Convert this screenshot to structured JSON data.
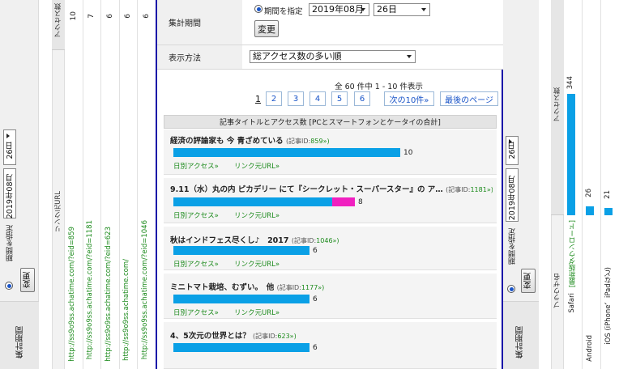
{
  "form": {
    "period_label": "集計期間",
    "radio_label": "期間を指定",
    "month_value": "2019年08月",
    "day_value": "26日",
    "change_button": "変更",
    "display_label": "表示方法",
    "sort_value": "総アクセス数の多い順"
  },
  "pagination": {
    "summary": "全 60 件中 1 - 10 件表示",
    "current": "1",
    "pages": [
      "2",
      "3",
      "4",
      "5",
      "6"
    ],
    "next": "次の10件»",
    "last": "最後のページ"
  },
  "section_header": "記事タイトルとアクセス数 [PCとスマートフォンとケータイの合計]",
  "articles": [
    {
      "title": "経済の評論家も 今 青ざめている",
      "id_prefix": "(記事ID:",
      "id": "859",
      "id_suffix": "»)",
      "blue": 10,
      "pink": 0,
      "count": "10",
      "daily": "日別アクセス»",
      "ref": "リンク元URL»"
    },
    {
      "title": "9.11（水）丸の内 ピカデリー にて『シークレット・スーパースター』の ア…",
      "id_prefix": "(記事ID:",
      "id": "1181",
      "id_suffix": "»)",
      "blue": 7,
      "pink": 1,
      "count": "8",
      "daily": "日別アクセス»",
      "ref": "リンク元URL»"
    },
    {
      "title": "秋はインドフェス尽くし♪　2017",
      "id_prefix": "(記事ID:",
      "id": "1046",
      "id_suffix": "»)",
      "blue": 6,
      "pink": 0,
      "count": "6",
      "daily": "日別アクセス»",
      "ref": "リンク元URL»"
    },
    {
      "title": "ミニトマト栽培、むずい。　他",
      "id_prefix": "(記事ID:",
      "id": "1177",
      "id_suffix": "»)",
      "blue": 6,
      "pink": 0,
      "count": "6",
      "daily": "日別アクセス»",
      "ref": "リンク元URL»"
    },
    {
      "title": "4、5次元の世界とは？",
      "id_prefix": "(記事ID:",
      "id": "623",
      "id_suffix": "»)",
      "blue": 6,
      "pink": 0,
      "count": "6",
      "daily": "",
      "ref": ""
    }
  ],
  "left_panel": {
    "period_label": "集計期間",
    "radio_label": "期間を指定",
    "month_value": "2019年08月",
    "day_value": "26日",
    "change_button": "変更",
    "col_header_access": "アクセス数",
    "col_header_url": "リンク元URL",
    "rows": [
      {
        "url": "http://ss9o9ss.achatime.com/?eid=859",
        "count": "10"
      },
      {
        "url": "http://ss9o9ss.achatime.com/?eid=1181",
        "count": "7"
      },
      {
        "url": "http://ss9o9ss.achatime.com/?eid=623",
        "count": "6"
      },
      {
        "url": "http://ss9o9ss.achatime.com/",
        "count": "6"
      },
      {
        "url": "http://ss9o9ss.achatime.com/?eid=1046",
        "count": "6"
      }
    ]
  },
  "right_panel": {
    "period_label": "集計期間",
    "radio_label": "期間を指定",
    "month_value": "2019年08月",
    "day_value": "26日",
    "change_button": "変更",
    "col_header_access": "アクセス数",
    "col_header_browser": "ブラウザ名",
    "rows": [
      {
        "name": "Safari",
        "link": "[最新版ダウンロード]",
        "count": "344",
        "value": 344
      },
      {
        "name": "Android",
        "link": "",
        "count": "26",
        "value": 26
      },
      {
        "name": "iOS (iPhone、iPadなど)",
        "link": "",
        "count": "21",
        "value": 21
      }
    ]
  },
  "colors": {
    "bar_blue": "#0aa0e6",
    "bar_pink": "#f020c0",
    "link_green": "#1b8a1b",
    "frame_blue": "#1a14a8"
  }
}
